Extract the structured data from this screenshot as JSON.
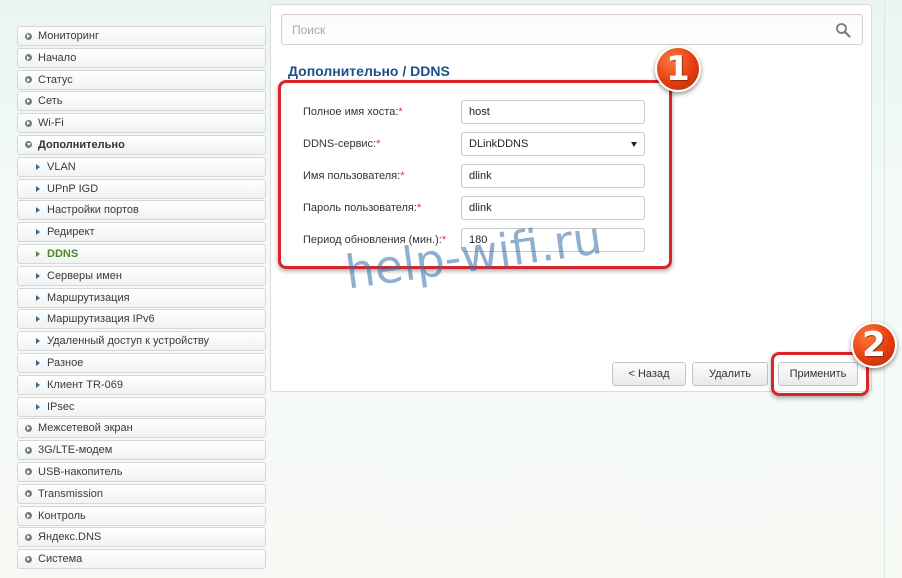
{
  "sidebar": {
    "items": [
      {
        "label": "Мониторинг",
        "level": 0,
        "icon": "arrow-right-icon"
      },
      {
        "label": "Начало",
        "level": 0,
        "icon": "arrow-right-icon"
      },
      {
        "label": "Статус",
        "level": 0,
        "icon": "arrow-right-icon"
      },
      {
        "label": "Сеть",
        "level": 0,
        "icon": "arrow-right-icon"
      },
      {
        "label": "Wi-Fi",
        "level": 0,
        "icon": "arrow-right-icon"
      },
      {
        "label": "Дополнительно",
        "level": 0,
        "icon": "arrow-down-icon",
        "expanded": true
      },
      {
        "label": "VLAN",
        "level": 1,
        "icon": "triangle-icon"
      },
      {
        "label": "UPnP IGD",
        "level": 1,
        "icon": "triangle-icon"
      },
      {
        "label": "Настройки портов",
        "level": 1,
        "icon": "triangle-icon"
      },
      {
        "label": "Редирект",
        "level": 1,
        "icon": "triangle-icon"
      },
      {
        "label": "DDNS",
        "level": 1,
        "icon": "triangle-icon",
        "active": true
      },
      {
        "label": "Серверы имен",
        "level": 1,
        "icon": "triangle-icon"
      },
      {
        "label": "Маршрутизация",
        "level": 1,
        "icon": "triangle-icon"
      },
      {
        "label": "Маршрутизация IPv6",
        "level": 1,
        "icon": "triangle-icon"
      },
      {
        "label": "Удаленный доступ к устройству",
        "level": 1,
        "icon": "triangle-icon"
      },
      {
        "label": "Разное",
        "level": 1,
        "icon": "triangle-icon"
      },
      {
        "label": "Клиент TR-069",
        "level": 1,
        "icon": "triangle-icon"
      },
      {
        "label": "IPsec",
        "level": 1,
        "icon": "triangle-icon"
      },
      {
        "label": "Межсетевой экран",
        "level": 0,
        "icon": "arrow-right-icon"
      },
      {
        "label": "3G/LTE-модем",
        "level": 0,
        "icon": "arrow-right-icon"
      },
      {
        "label": "USB-накопитель",
        "level": 0,
        "icon": "arrow-right-icon"
      },
      {
        "label": "Transmission",
        "level": 0,
        "icon": "arrow-right-icon"
      },
      {
        "label": "Контроль",
        "level": 0,
        "icon": "arrow-right-icon"
      },
      {
        "label": "Яндекс.DNS",
        "level": 0,
        "icon": "arrow-right-icon"
      },
      {
        "label": "Система",
        "level": 0,
        "icon": "arrow-right-icon"
      }
    ]
  },
  "search": {
    "placeholder": "Поиск",
    "value": "",
    "icon": "search-icon"
  },
  "page": {
    "title": "Дополнительно /  DDNS"
  },
  "form": {
    "required_mark": "*",
    "hostname": {
      "label": "Полное имя хоста:",
      "value": "host"
    },
    "service": {
      "label": "DDNS-сервис:",
      "value": "DLinkDDNS"
    },
    "username": {
      "label": "Имя пользователя:",
      "value": "dlink"
    },
    "password": {
      "label": "Пароль пользователя:",
      "value": "dlink"
    },
    "period": {
      "label": "Период обновления (мин.):",
      "value": "180"
    }
  },
  "buttons": {
    "back": "< Назад",
    "delete": "Удалить",
    "apply": "Применить"
  },
  "annotations": {
    "marker_1": "1",
    "marker_2": "2",
    "watermark": "help-wifi.ru",
    "highlight_color": "#d9242a",
    "marker_color": "#e53d10"
  },
  "colors": {
    "title": "#1d4f8a",
    "active_item": "#4b8a2a",
    "required": "#e03030"
  }
}
